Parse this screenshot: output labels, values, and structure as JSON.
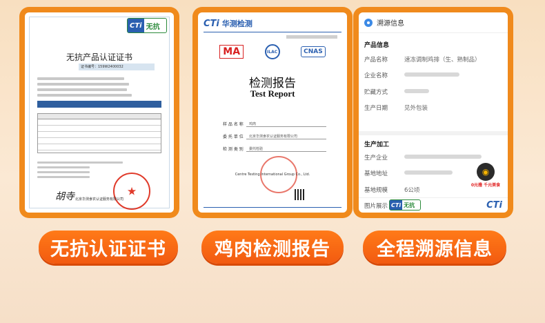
{
  "certificate": {
    "badge_cti": "CTi",
    "badge_text": "无抗",
    "title": "无抗产品认证证书",
    "number_label": "证书编号：159W2400032",
    "org": "北京华测食农认证服务有限公司",
    "sign": "胡寺"
  },
  "report": {
    "header_logo": "CTi",
    "header_name": "华测检测",
    "logos": [
      "MA",
      "ILAC",
      "CNAS"
    ],
    "title_cn": "检测报告",
    "title_en": "Test Report",
    "fields": [
      {
        "label": "样 品 名 称",
        "value": "鸡肉"
      },
      {
        "label": "委 托 单 位",
        "value": "北京华测食农认证服务有限公司"
      },
      {
        "label": "检 测 类 别",
        "value": "委托检验"
      }
    ],
    "org": "Centre Testing International Group Co., Ltd."
  },
  "trace": {
    "header": "溯源信息",
    "product_section": "产品信息",
    "product_rows": [
      {
        "label": "产品名称",
        "value": "速冻调制鸡排（生、熟制品）"
      },
      {
        "label": "企业名称",
        "value": ""
      },
      {
        "label": "贮藏方式",
        "value": ""
      },
      {
        "label": "生产日期",
        "value": "见外包装"
      }
    ],
    "production_section": "生产加工",
    "production_rows": [
      {
        "label": "生产企业",
        "value": ""
      },
      {
        "label": "基地地址",
        "value": ""
      },
      {
        "label": "基地规模",
        "value": "6公顷"
      },
      {
        "label": "图片展示",
        "value": ""
      }
    ],
    "logo_text": "0元撸 千元美食",
    "badge_cti": "CTi",
    "badge_text": "无抗",
    "footer_logo": "CTi"
  },
  "buttons": {
    "cert": "无抗认证证书",
    "report": "鸡肉检测报告",
    "trace": "全程溯源信息"
  }
}
